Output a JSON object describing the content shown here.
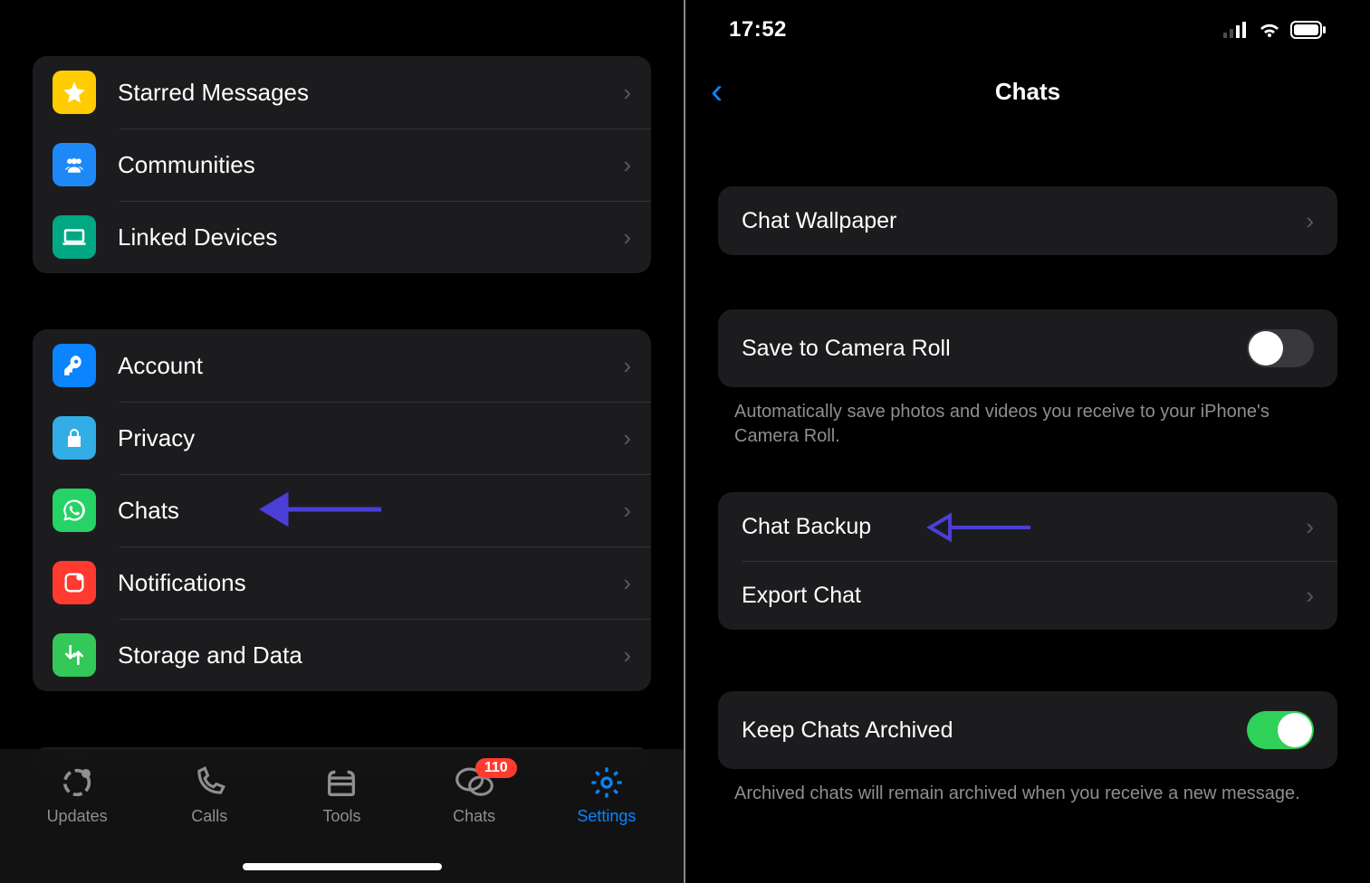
{
  "left": {
    "group1": [
      {
        "label": "Starred Messages",
        "icon": "star-icon",
        "color": "ic-yellow"
      },
      {
        "label": "Communities",
        "icon": "communities-icon",
        "color": "ic-blue"
      },
      {
        "label": "Linked Devices",
        "icon": "laptop-icon",
        "color": "ic-teal"
      }
    ],
    "group2": [
      {
        "label": "Account",
        "icon": "key-icon",
        "color": "ic-blue2"
      },
      {
        "label": "Privacy",
        "icon": "lock-icon",
        "color": "ic-cyan"
      },
      {
        "label": "Chats",
        "icon": "whatsapp-icon",
        "color": "ic-green",
        "annotate": true
      },
      {
        "label": "Notifications",
        "icon": "notification-icon",
        "color": "ic-red"
      },
      {
        "label": "Storage and Data",
        "icon": "storage-icon",
        "color": "ic-green2"
      }
    ],
    "tabs": [
      {
        "label": "Updates",
        "icon": "updates-icon"
      },
      {
        "label": "Calls",
        "icon": "calls-icon"
      },
      {
        "label": "Tools",
        "icon": "tools-icon"
      },
      {
        "label": "Chats",
        "icon": "chats-icon",
        "badge": "110"
      },
      {
        "label": "Settings",
        "icon": "settings-icon",
        "active": true
      }
    ]
  },
  "right": {
    "status_time": "17:52",
    "nav_title": "Chats",
    "group1": [
      {
        "label": "Chat Wallpaper"
      }
    ],
    "group2": [
      {
        "label": "Save to Camera Roll",
        "toggle": "off"
      }
    ],
    "footer2": "Automatically save photos and videos you receive to your iPhone's Camera Roll.",
    "group3": [
      {
        "label": "Chat Backup",
        "annotate": true
      },
      {
        "label": "Export Chat"
      }
    ],
    "group4": [
      {
        "label": "Keep Chats Archived",
        "toggle": "on"
      }
    ],
    "footer4": "Archived chats will remain archived when you receive a new message."
  },
  "annotation_color": "#4a3fd6"
}
